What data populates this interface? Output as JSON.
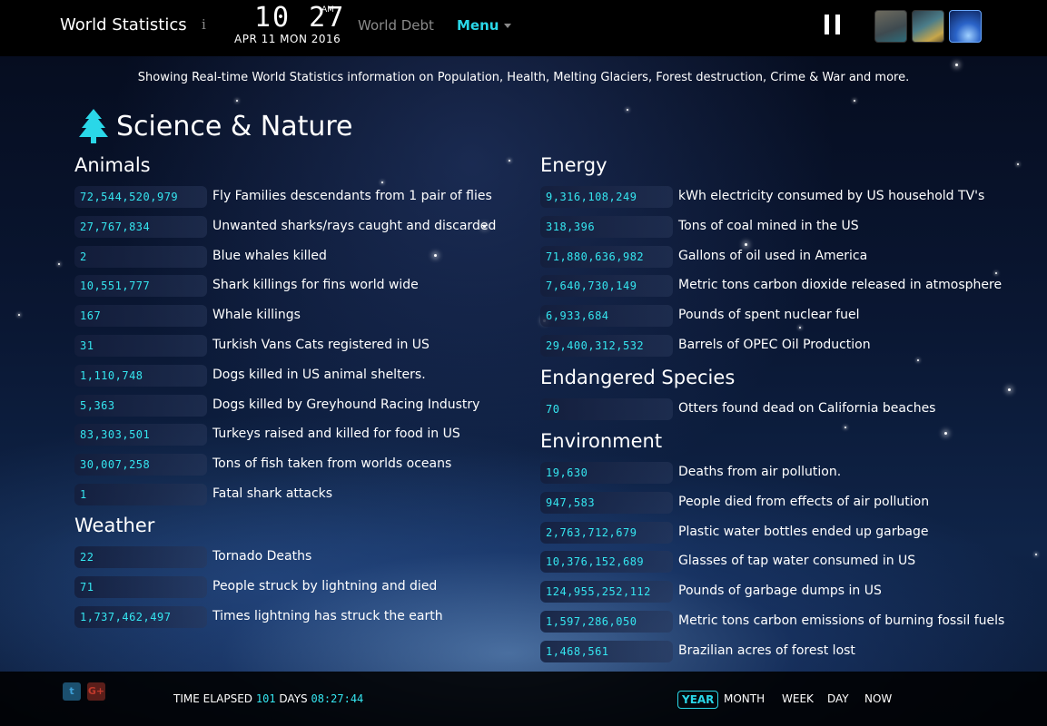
{
  "header": {
    "brand": "World Statistics",
    "clock_time": "10 27",
    "clock_ampm": "AM",
    "clock_date": "APR 11 MON 2016",
    "nav_debt": "World Debt",
    "nav_menu": "Menu"
  },
  "tagline": "Showing Real-time World Statistics information on Population, Health, Melting Glaciers, Forest destruction, Crime & War and more.",
  "page_title": "Science & Nature",
  "sections": {
    "animals": {
      "title": "Animals",
      "rows": [
        {
          "value": "72,544,520,979",
          "label": "Fly Families descendants from 1 pair of flies"
        },
        {
          "value": "27,767,834",
          "label": "Unwanted sharks/rays caught and discarded"
        },
        {
          "value": "2",
          "label": "Blue whales killed"
        },
        {
          "value": "10,551,777",
          "label": "Shark killings for fins world wide"
        },
        {
          "value": "167",
          "label": "Whale killings"
        },
        {
          "value": "31",
          "label": "Turkish Vans Cats registered in US"
        },
        {
          "value": "1,110,748",
          "label": "Dogs killed in US animal shelters."
        },
        {
          "value": "5,363",
          "label": "Dogs killed by Greyhound Racing Industry"
        },
        {
          "value": "83,303,501",
          "label": "Turkeys raised and killed for food in US"
        },
        {
          "value": "30,007,258",
          "label": "Tons of fish taken from worlds oceans"
        },
        {
          "value": "1",
          "label": "Fatal shark attacks"
        }
      ]
    },
    "weather": {
      "title": "Weather",
      "rows": [
        {
          "value": "22",
          "label": "Tornado Deaths"
        },
        {
          "value": "71",
          "label": "People struck by lightning and died"
        },
        {
          "value": "1,737,462,497",
          "label": "Times lightning has struck the earth"
        }
      ]
    },
    "energy": {
      "title": "Energy",
      "rows": [
        {
          "value": "9,316,108,249",
          "label": "kWh electricity consumed by US household TV's"
        },
        {
          "value": "318,396",
          "label": "Tons of coal mined in the US"
        },
        {
          "value": "71,880,636,982",
          "label": "Gallons of oil used in America"
        },
        {
          "value": "7,640,730,149",
          "label": "Metric tons carbon dioxide released in atmosphere"
        },
        {
          "value": "6,933,684",
          "label": "Pounds of spent nuclear fuel"
        },
        {
          "value": "29,400,312,532",
          "label": "Barrels of OPEC Oil Production"
        }
      ]
    },
    "endangered": {
      "title": "Endangered Species",
      "rows": [
        {
          "value": "70",
          "label": "Otters found dead on California beaches"
        }
      ]
    },
    "environment": {
      "title": "Environment",
      "rows": [
        {
          "value": "19,630",
          "label": "Deaths from air pollution."
        },
        {
          "value": "947,583",
          "label": "People died from effects of air pollution"
        },
        {
          "value": "2,763,712,679",
          "label": "Plastic water bottles ended up garbage"
        },
        {
          "value": "10,376,152,689",
          "label": "Glasses of tap water consumed in US"
        },
        {
          "value": "124,955,252,112",
          "label": "Pounds of garbage dumps in US"
        },
        {
          "value": "1,597,286,050",
          "label": "Metric tons carbon emissions of burning fossil fuels"
        },
        {
          "value": "1,468,561",
          "label": "Brazilian acres of forest lost"
        }
      ]
    }
  },
  "footer": {
    "elapsed_label": "TIME ELAPSED",
    "elapsed_days_value": "101",
    "elapsed_days_label": "DAYS",
    "elapsed_time": "08:27:44",
    "ranges": [
      "YEAR",
      "MONTH",
      "WEEK",
      "DAY",
      "NOW"
    ],
    "active_range": "YEAR"
  },
  "icons": {
    "info": "info-icon",
    "tree": "tree-icon",
    "pause": "pause-icon",
    "twitter": "twitter-icon",
    "google_plus": "google-plus-icon"
  },
  "colors": {
    "accent": "#2ad7e8",
    "counter_text": "#35e6f0",
    "muted": "#8a8a8a"
  }
}
